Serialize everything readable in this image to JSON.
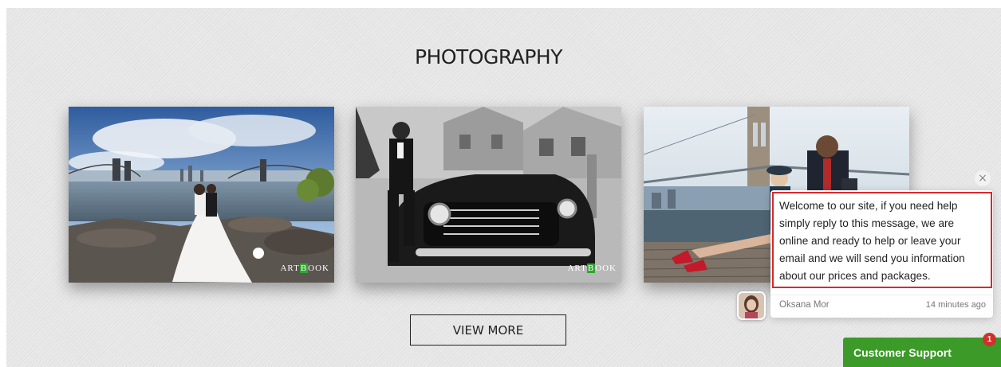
{
  "section": {
    "title": "PHOTOGRAPHY",
    "view_more_label": "VIEW MORE"
  },
  "gallery": [
    {
      "watermark_pre": "A",
      "watermark_mid": "RT",
      "watermark_green": "B",
      "watermark_post": "OOK"
    },
    {
      "watermark_pre": "A",
      "watermark_mid": "RT",
      "watermark_green": "B",
      "watermark_post": "OOK"
    }
  ],
  "chat": {
    "close_label": "×",
    "message": "Welcome to our site, if you need help simply reply to this message, we are online and ready to help or leave your email and we will send you information about our prices and packages.",
    "agent_name": "Oksana Mor",
    "time": "14 minutes ago",
    "support_label": "Customer Support",
    "unread_count": "1"
  },
  "colors": {
    "accent_green": "#3c9a28",
    "highlight_red": "#d9292b",
    "badge_red": "#d0312d"
  }
}
